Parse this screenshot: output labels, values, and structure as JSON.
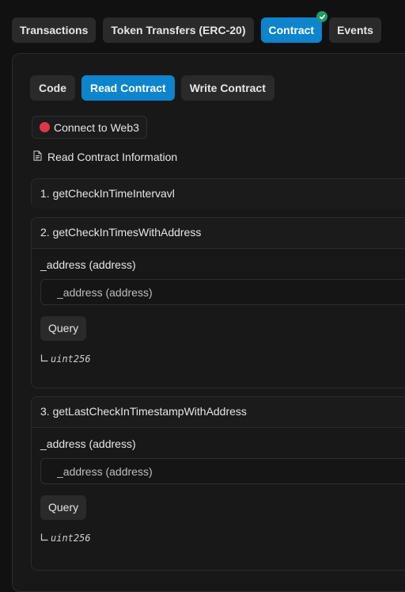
{
  "tabs": [
    {
      "label": "Transactions",
      "active": false
    },
    {
      "label": "Token Transfers (ERC-20)",
      "active": false
    },
    {
      "label": "Contract",
      "active": true,
      "verified": true
    },
    {
      "label": "Events",
      "active": false
    }
  ],
  "subtabs": [
    {
      "label": "Code",
      "active": false
    },
    {
      "label": "Read Contract",
      "active": true
    },
    {
      "label": "Write Contract",
      "active": false
    }
  ],
  "connect": {
    "label": "Connect to Web3",
    "status_color": "#e0364a"
  },
  "section_title": "Read Contract Information",
  "functions": [
    {
      "header": "1. getCheckInTimeIntervavl"
    },
    {
      "header": "2. getCheckInTimesWithAddress",
      "param_label": "_address (address)",
      "placeholder": "_address (address)",
      "query_label": "Query",
      "output_type": "uint256"
    },
    {
      "header": "3. getLastCheckInTimestampWithAddress",
      "param_label": "_address (address)",
      "placeholder": "_address (address)",
      "query_label": "Query",
      "output_type": "uint256"
    }
  ],
  "colors": {
    "accent": "#0d84cc",
    "verified_badge": "#1f9a6a",
    "background": "#111111",
    "panel": "#181818"
  },
  "icons": {
    "verified": "check-icon",
    "section": "document-icon",
    "output": "corner-arrow-icon"
  }
}
